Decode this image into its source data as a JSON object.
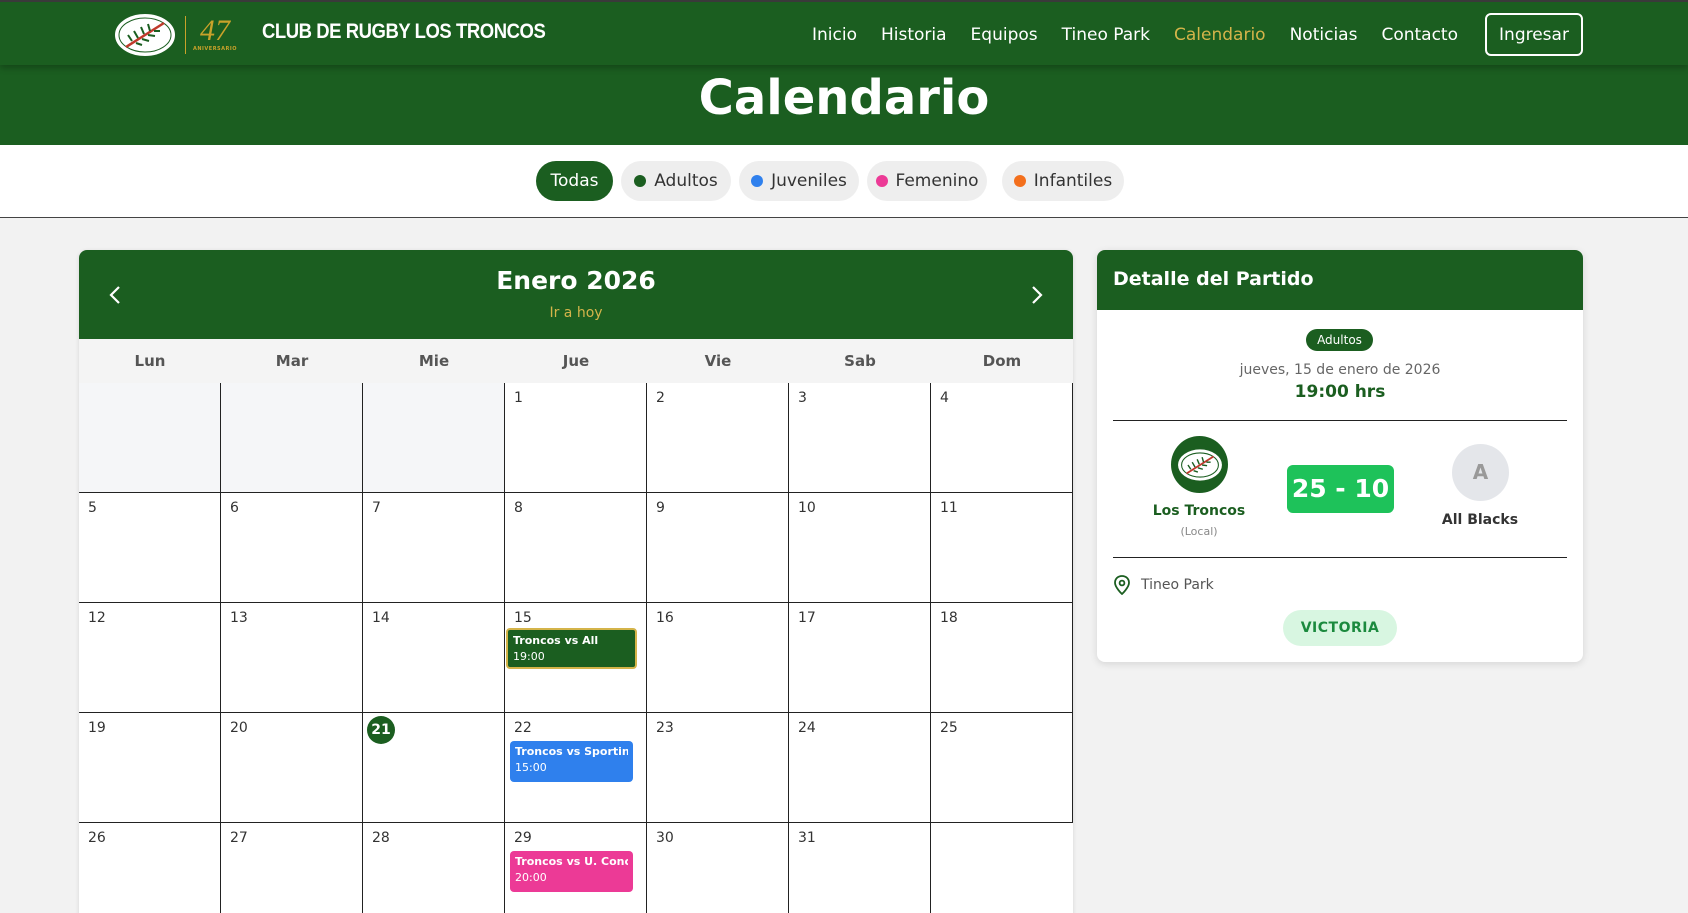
{
  "nav": {
    "club_name": "CLUB DE RUGBY LOS TRONCOS",
    "anniversary_number": "47",
    "anniversary_label": "ANIVERSARIO",
    "links": [
      "Inicio",
      "Historia",
      "Equipos",
      "Tineo Park",
      "Calendario",
      "Noticias",
      "Contacto"
    ],
    "active_link": "Calendario",
    "login_label": "Ingresar"
  },
  "page": {
    "title": "Calendario"
  },
  "filters": [
    {
      "label": "Todas",
      "active": true
    },
    {
      "label": "Adultos",
      "color": "#1b5e20"
    },
    {
      "label": "Juveniles",
      "color": "#2f80ed"
    },
    {
      "label": "Femenino",
      "color": "#ec3a96"
    },
    {
      "label": "Infantiles",
      "color": "#f36f1c"
    }
  ],
  "calendar": {
    "month_label": "Enero 2026",
    "today_link": "Ir a hoy",
    "weekdays": [
      "Lun",
      "Mar",
      "Mie",
      "Jue",
      "Vie",
      "Sab",
      "Dom"
    ],
    "leading_empty": 3,
    "days_in_month": 31,
    "today": 21,
    "events": [
      {
        "day": 15,
        "title": "Troncos vs All",
        "time": "19:00",
        "color": "#1b5e20",
        "selected": true
      },
      {
        "day": 22,
        "title": "Troncos vs Sporting",
        "time": "15:00",
        "color": "#2f80ed"
      },
      {
        "day": 29,
        "title": "Troncos vs U. Conce",
        "time": "20:00",
        "color": "#ec3a96"
      }
    ]
  },
  "detail": {
    "header": "Detalle del Partido",
    "category": "Adultos",
    "date": "jueves, 15 de enero de 2026",
    "time": "19:00 hrs",
    "home_team": "Los Troncos",
    "home_role": "(Local)",
    "score": "25 - 10",
    "away_initial": "A",
    "away_team": "All Blacks",
    "venue": "Tineo Park",
    "result": "VICTORIA"
  },
  "colors": {
    "primary_green": "#1b5e20",
    "gold": "#d4b44a",
    "score_green": "#1ec25a",
    "result_bg": "#d8f6e1"
  }
}
